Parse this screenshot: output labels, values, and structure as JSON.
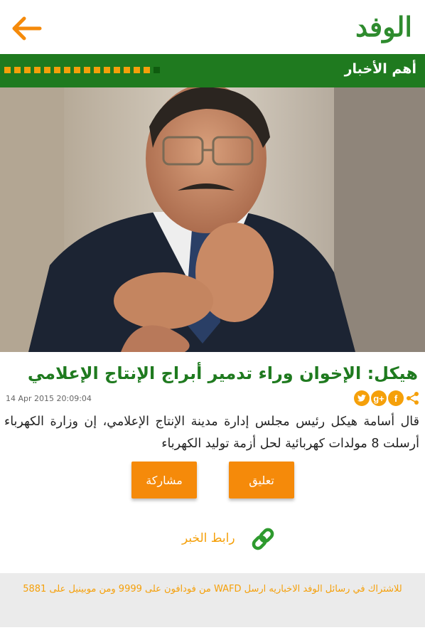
{
  "header": {
    "logo_text": "الوفد",
    "back_icon": "arrow-left-icon",
    "accent_color": "#f58a0a",
    "brand_green": "#1f7a1f"
  },
  "section": {
    "title": "أهم الأخبار"
  },
  "article": {
    "headline": "هيكل: الإخوان وراء تدمير أبراج الإنتاج الإعلامي",
    "timestamp": "14 Apr 2015 20:09:04",
    "body": "قال أسامة هيكل رئيس مجلس إدارة مدينة الإنتاج الإعلامي، إن وزارة الكهرباء أرسلت 8 مولدات كهربائية لحل أزمة توليد الكهرباء",
    "share_icons": {
      "share": "share-icon",
      "facebook": "f",
      "google": "g+",
      "twitter": "twitter-icon"
    }
  },
  "actions": {
    "share_label": "مشاركة",
    "comment_label": "تعليق",
    "news_link_label": "رابط الخبر"
  },
  "footer": {
    "subscribe_text": "للاشتراك في رسائل الوفد الاخباريه ارسل WAFD من فودافون على 9999 ومن موبينيل على 5881"
  }
}
